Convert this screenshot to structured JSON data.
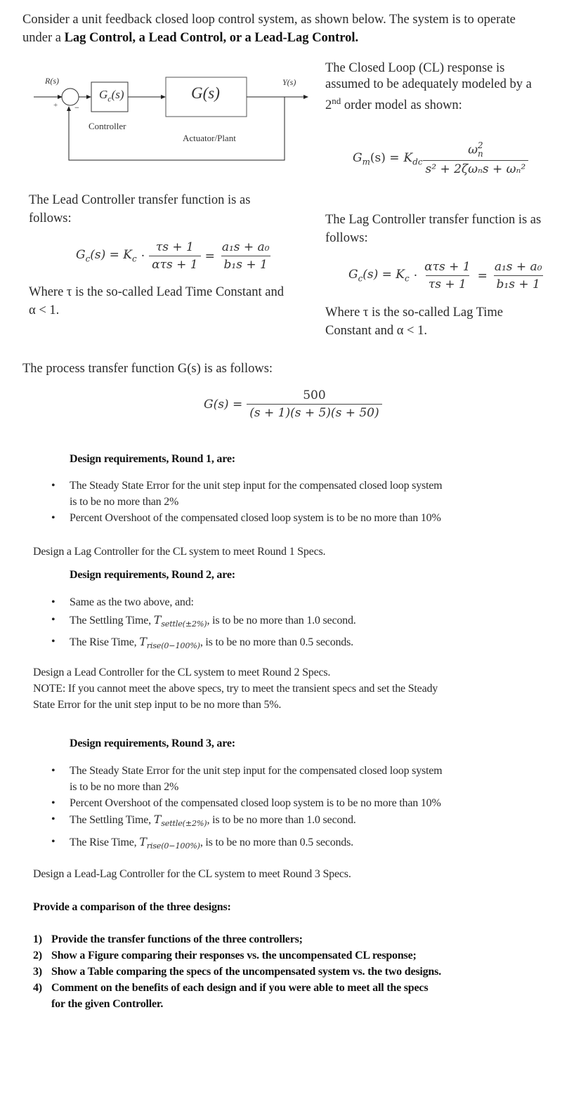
{
  "intro": {
    "line1": "Consider a unit feedback closed loop control system, as shown below. The system is to operate",
    "line2_prefix": "under a ",
    "line2_bold": "Lag Control, a Lead Control, or a Lead-Lag Control."
  },
  "block_diagram": {
    "input_label": "R(s)",
    "plus_sign": "+",
    "minus_sign": "−",
    "controller_block": "Gc(s)",
    "controller_block_main": "G",
    "controller_block_sub": "c",
    "controller_block_arg": "(s)",
    "controller_caption": "Controller",
    "plant_block": "G(s)",
    "plant_caption": "Actuator/Plant",
    "output_label": "Y(s)"
  },
  "cl_model": {
    "text_lines": [
      "The Closed Loop (CL) response is",
      "assumed to be adequately modeled by a"
    ],
    "line3_num": "2",
    "line3_sup": "nd",
    "line3_rest": " order model as shown:",
    "lhs": "G",
    "lhs_sub": "m",
    "lhs_arg": "(s) =",
    "gain": "K",
    "gain_sub": "dc",
    "numerator": "ω",
    "numerator_sup": "2",
    "numerator_sub": "n",
    "denominator": "s² + 2ζωₙs + ωₙ²"
  },
  "lead": {
    "heading_lines": [
      "The Lead Controller transfer function is as",
      "follows:"
    ],
    "lhs": "G",
    "lhs_sub": "c",
    "lhs_arg": "(s) = K",
    "gain_sub": "c",
    "dot": "·",
    "frac1_num": "τs + 1",
    "frac1_den": "ατs + 1",
    "equals": "=",
    "frac2_num": "a₁s + a₀",
    "frac2_den": "b₁s + 1",
    "note_lines": [
      "Where τ is the so-called Lead Time Constant and",
      "α <  1."
    ]
  },
  "lag": {
    "heading_lines": [
      "The Lag Controller transfer function is as",
      "follows:"
    ],
    "lhs": "G",
    "lhs_sub": "c",
    "lhs_arg": "(s) = K",
    "gain_sub": "c",
    "dot": "·",
    "frac1_num": "ατs + 1",
    "frac1_den": "τs + 1",
    "equals": "=",
    "frac2_num": "a₁s + a₀",
    "frac2_den": "b₁s + 1",
    "note_lines": [
      "Where τ is the so-called Lag Time",
      "Constant and α <  1."
    ]
  },
  "process": {
    "heading": "The process transfer function G(s) is as follows:",
    "lhs": "G(s) =",
    "numerator": "500",
    "denominator": "(s + 1)(s + 5)(s + 50)"
  },
  "round1": {
    "heading": "Design requirements, Round 1, are:",
    "bullets": [
      [
        "The Steady State Error for the unit step input for the compensated closed loop system",
        "is to be no more than 2%"
      ],
      [
        "Percent Overshoot of the compensated closed loop system is to be no more than 10%"
      ]
    ],
    "task": "Design a Lag Controller for the CL system to meet Round 1 Specs."
  },
  "round2": {
    "heading": "Design requirements, Round 2, are:",
    "bullet1": "Same as the two above, and:",
    "settle_prefix": "The Settling Time, ",
    "settle_sym": "T",
    "settle_sub": "settle(±2%)",
    "settle_suffix": ", is to be no more than 1.0 second.",
    "rise_prefix": "The Rise Time, ",
    "rise_sym": "T",
    "rise_sub": "rise(0−100%)",
    "rise_suffix": ", is to be no more than 0.5 seconds.",
    "task_lines": [
      "Design a Lead Controller for the CL system to meet Round 2 Specs.",
      "NOTE: If you cannot meet the above specs, try to meet the transient specs and set the Steady",
      "State Error for the unit step input to be no more than 5%."
    ]
  },
  "round3": {
    "heading": "Design requirements, Round 3, are:",
    "sse_lines": [
      "The Steady State Error for the unit step input for the compensated closed loop system",
      "is to be no more than 2%"
    ],
    "overshoot": "Percent Overshoot of the compensated closed loop system is to be no more than 10%",
    "settle_prefix": "The Settling Time, ",
    "settle_sym": "T",
    "settle_sub": "settle(±2%)",
    "settle_suffix": ", is to be no more than 1.0 second.",
    "rise_prefix": "The Rise Time, ",
    "rise_sym": "T",
    "rise_sub": "rise(0−100%)",
    "rise_suffix": ", is to be no more than 0.5 seconds.",
    "task": "Design a Lead-Lag Controller for the CL system to meet Round 3 Specs."
  },
  "comparison": {
    "heading": "Provide a comparison of the three designs:",
    "items": [
      {
        "n": "1)",
        "lines": [
          "Provide the transfer functions of the three controllers;"
        ]
      },
      {
        "n": "2)",
        "lines": [
          "Show a Figure comparing their responses vs. the uncompensated CL response;"
        ]
      },
      {
        "n": "3)",
        "lines": [
          "Show a Table comparing the specs of the uncompensated system vs. the two designs."
        ]
      },
      {
        "n": "4)",
        "lines": [
          "Comment on the benefits of each design and if you were able to meet all the specs",
          "for the given Controller."
        ]
      }
    ]
  }
}
